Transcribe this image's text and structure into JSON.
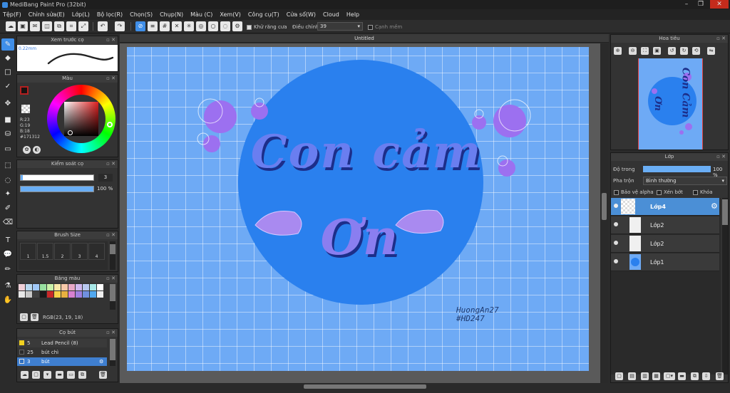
{
  "window": {
    "title": "MediBang Paint Pro (32bit)",
    "min": "–",
    "max": "❐",
    "close": "✕"
  },
  "menu": [
    "Tệp(F)",
    "Chỉnh sửa(E)",
    "Lớp(L)",
    "Bộ lọc(R)",
    "Chọn(S)",
    "Chụp(N)",
    "Màu (C)",
    "Xem(V)",
    "Công cụ(T)",
    "Cửa sổ(W)",
    "Cloud",
    "Help"
  ],
  "toolbar": {
    "antialias_label": "Khử răng cưa",
    "correction_label": "Điều chỉnh",
    "correction_value": "39",
    "snap_label": "Cạnh mềm"
  },
  "brush_preview": {
    "title": "Xem trước cọ",
    "size_label": "0.22mm"
  },
  "color": {
    "title": "Màu",
    "r": "R:23",
    "g": "G:19",
    "b": "B:18",
    "hex": "#171312",
    "fg": "#b32020",
    "bg": "#1d6fe0"
  },
  "brush_control": {
    "title": "Kiểm soát cọ",
    "size_value": "3",
    "opacity_value": "100 %",
    "opacity_level": 1.0
  },
  "brush_size": {
    "title": "Brush Size",
    "sizes": [
      "1",
      "1.5",
      "2",
      "3",
      "4"
    ]
  },
  "palette": {
    "title": "Bảng màu",
    "rgb_label": "RGB(23, 19, 18)",
    "swatches": [
      "#f0d0d8",
      "#b8d8f0",
      "#a0c8f8",
      "#98e0a0",
      "#c8f0a8",
      "#f8e8a8",
      "#f8c8a8",
      "#e8a8c8",
      "#d0b8f0",
      "#b8c8f0",
      "#a8e8e8",
      "#ffffff",
      "#e8e8e8",
      "#c8c8c8",
      "#404040",
      "#1a1a1a",
      "#c82828",
      "#f8d048",
      "#e8b040",
      "#d880d0",
      "#a080e0",
      "#7090e0",
      "#50a8f0",
      "#f0f0f0"
    ]
  },
  "brushes": {
    "title": "Cọ bút",
    "items": [
      {
        "size": "5",
        "name": "Lead Pencil (8)",
        "color": "#f0d020"
      },
      {
        "size": "25",
        "name": "bút chì",
        "color": "#2a2a2a"
      },
      {
        "size": "3",
        "name": "bút",
        "color": "#3070c0"
      }
    ]
  },
  "canvas": {
    "tab_title": "Untitled",
    "line1": "Con cảm",
    "line2": "Ơn",
    "signature1": "HuongAn27",
    "signature2": "#HD247"
  },
  "navigator": {
    "title": "Hoa tiêu",
    "preview_text1": "Con",
    "preview_text2": "Cảm",
    "preview_text3": "Ơn"
  },
  "layers": {
    "title": "Lớp",
    "opacity_label": "Độ trong",
    "opacity_value": "100 %",
    "opacity_level": 1.0,
    "blend_label": "Pha trộn",
    "blend_value": "Bình thường",
    "protect_alpha": "Bảo vệ alpha",
    "clip": "Xén bớt",
    "lock": "Khóa",
    "items": [
      {
        "name": "Lớp4",
        "selected": true
      },
      {
        "name": "Lớp2",
        "selected": false
      },
      {
        "name": "Lớp2",
        "selected": false
      },
      {
        "name": "Lớp1",
        "selected": false
      }
    ]
  }
}
